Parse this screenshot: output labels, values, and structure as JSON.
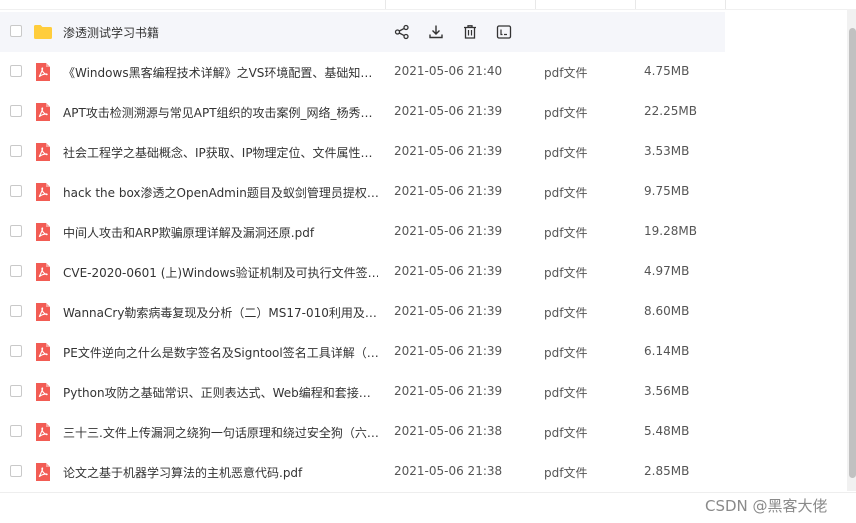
{
  "folder": {
    "name": "渗透测试学习书籍",
    "actions": [
      "share-icon",
      "download-icon",
      "delete-icon",
      "more-icon"
    ]
  },
  "files": [
    {
      "name": "《Windows黑客编程技术详解》之VS环境配置、基础知…",
      "time": "2021-05-06 21:40",
      "type": "pdf文件",
      "size": "4.75MB"
    },
    {
      "name": "APT攻击检测溯源与常见APT组织的攻击案例_网络_杨秀…",
      "time": "2021-05-06 21:39",
      "type": "pdf文件",
      "size": "22.25MB"
    },
    {
      "name": "社会工程学之基础概念、IP获取、IP物理定位、文件属性…",
      "time": "2021-05-06 21:39",
      "type": "pdf文件",
      "size": "3.53MB"
    },
    {
      "name": "hack the box渗透之OpenAdmin题目及蚁剑管理员提权…",
      "time": "2021-05-06 21:39",
      "type": "pdf文件",
      "size": "9.75MB"
    },
    {
      "name": "中间人攻击和ARP欺骗原理详解及漏洞还原.pdf",
      "time": "2021-05-06 21:39",
      "type": "pdf文件",
      "size": "19.28MB"
    },
    {
      "name": "CVE-2020-0601 (上)Windows验证机制及可执行文件签…",
      "time": "2021-05-06 21:39",
      "type": "pdf文件",
      "size": "4.97MB"
    },
    {
      "name": "WannaCry勒索病毒复现及分析（二）MS17-010利用及…",
      "time": "2021-05-06 21:39",
      "type": "pdf文件",
      "size": "8.60MB"
    },
    {
      "name": "PE文件逆向之什么是数字签名及Signtool签名工具详解（…",
      "time": "2021-05-06 21:39",
      "type": "pdf文件",
      "size": "6.14MB"
    },
    {
      "name": "Python攻防之基础常识、正则表达式、Web编程和套接…",
      "time": "2021-05-06 21:39",
      "type": "pdf文件",
      "size": "3.56MB"
    },
    {
      "name": "三十三.文件上传漏洞之绕狗一句话原理和绕过安全狗（六…",
      "time": "2021-05-06 21:38",
      "type": "pdf文件",
      "size": "5.48MB"
    },
    {
      "name": "论文之基于机器学习算法的主机恶意代码.pdf",
      "time": "2021-05-06 21:38",
      "type": "pdf文件",
      "size": "2.85MB"
    }
  ],
  "watermark": "CSDN @黑客大佬",
  "colors": {
    "pdf": "#f25c54",
    "folder": "#ffcd3c",
    "highlight": "#f5f6fa"
  }
}
